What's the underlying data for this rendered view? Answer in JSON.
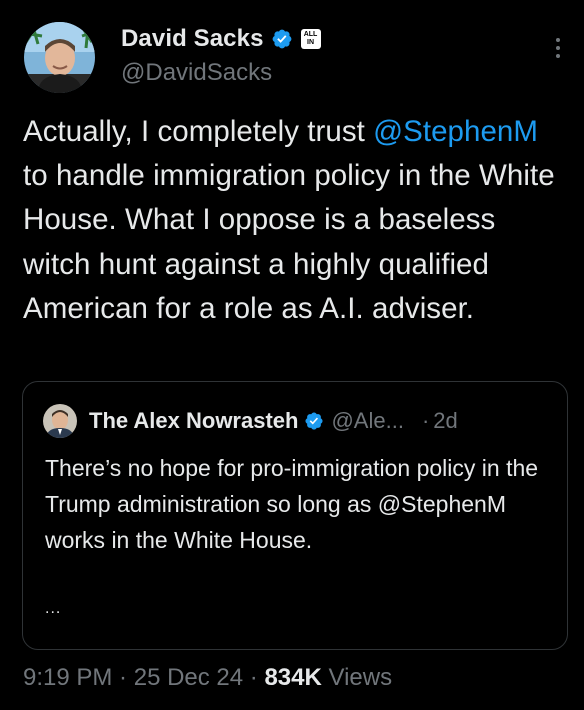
{
  "author": {
    "display_name": "David Sacks",
    "handle": "@DavidSacks",
    "affiliate_badge": "ALL IN",
    "avatar_icon": "avatar-photo-icon",
    "verified_color": "#1d9bf0"
  },
  "tweet": {
    "text_before": "Actually, I completely trust ",
    "mention": "@StephenM",
    "text_after": " to handle immigration policy in the White House. What I oppose is a baseless witch hunt against a highly qualified American for a role as A.I. adviser."
  },
  "quote": {
    "display_name": "The Alex Nowrasteh",
    "handle": "@Ale...",
    "separator": "·",
    "time": "2d",
    "text": "There’s no hope for pro-immigration policy in the Trump administration so long as @StephenM works in the White House.",
    "ellipsis": "..."
  },
  "meta": {
    "time": "9:19 PM",
    "sep1": " · ",
    "date": "25 Dec 24",
    "sep2": " · ",
    "views_count": "834K",
    "views_label": " Views"
  },
  "colors": {
    "background": "#000000",
    "text": "#e7e9ea",
    "secondary": "#71767b",
    "link": "#1d9bf0",
    "border": "#2f3336"
  }
}
